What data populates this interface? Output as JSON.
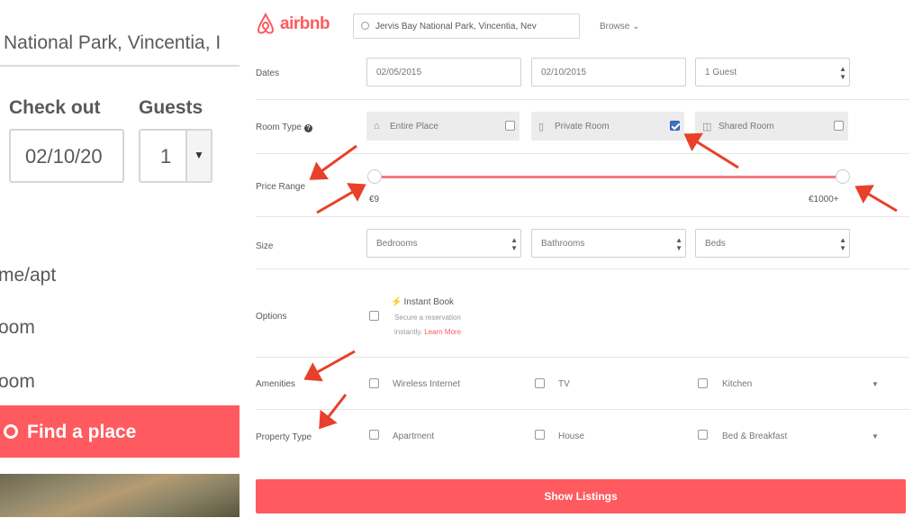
{
  "left_panel": {
    "location_text": "National Park, Vincentia, I",
    "check_out_label": "Check out",
    "guests_label": "Guests",
    "check_out_value": "02/10/20",
    "guests_value": "1",
    "room_options": [
      "me/apt",
      "oom",
      "oom"
    ],
    "find_button": "Find a place"
  },
  "header": {
    "logo_text": "airbnb",
    "search_value": "Jervis Bay National Park, Vincentia, Nev",
    "browse_label": "Browse"
  },
  "filters": {
    "dates": {
      "label": "Dates",
      "check_in": "02/05/2015",
      "check_out": "02/10/2015",
      "guests": "1 Guest"
    },
    "room_type": {
      "label": "Room Type",
      "options": [
        {
          "label": "Entire Place",
          "icon": "house-icon",
          "checked": false
        },
        {
          "label": "Private Room",
          "icon": "door-icon",
          "checked": true
        },
        {
          "label": "Shared Room",
          "icon": "couch-icon",
          "checked": false
        }
      ]
    },
    "price_range": {
      "label": "Price Range",
      "min": "€9",
      "max": "€1000+"
    },
    "size": {
      "label": "Size",
      "bedrooms": "Bedrooms",
      "bathrooms": "Bathrooms",
      "beds": "Beds"
    },
    "options": {
      "label": "Options",
      "title": "Instant Book",
      "line1": "Secure a reservation",
      "line2": "instantly.",
      "link": "Learn More"
    },
    "amenities": {
      "label": "Amenities",
      "items": [
        "Wireless Internet",
        "TV",
        "Kitchen"
      ]
    },
    "property_type": {
      "label": "Property Type",
      "items": [
        "Apartment",
        "House",
        "Bed & Breakfast"
      ]
    }
  },
  "show_listings": "Show Listings",
  "colors": {
    "brand": "#ff5a5f",
    "annotation_arrow": "#e8402a",
    "checkbox_checked": "#3d74c9"
  }
}
